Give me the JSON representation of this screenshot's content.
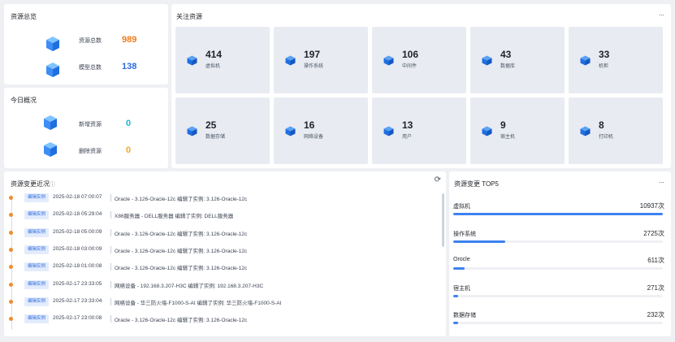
{
  "overview": {
    "title": "资源总览",
    "total_label": "资源总数",
    "total_value": "989",
    "model_label": "模型总数",
    "model_value": "138"
  },
  "today": {
    "title": "今日概况",
    "new_label": "新增资源",
    "new_value": "0",
    "deleted_label": "删除资源",
    "deleted_value": "0"
  },
  "focus": {
    "title": "关注资源",
    "more": "···",
    "tiles": [
      {
        "count": "414",
        "label": "虚拟机"
      },
      {
        "count": "197",
        "label": "操作系统"
      },
      {
        "count": "106",
        "label": "中间件"
      },
      {
        "count": "43",
        "label": "数据库"
      },
      {
        "count": "33",
        "label": "机柜"
      },
      {
        "count": "25",
        "label": "数据存储"
      },
      {
        "count": "16",
        "label": "网络设备"
      },
      {
        "count": "13",
        "label": "用户"
      },
      {
        "count": "9",
        "label": "宿主机"
      },
      {
        "count": "8",
        "label": "打印机"
      }
    ]
  },
  "changes": {
    "title": "资源变更近况",
    "info_icon": "ⓘ",
    "refresh_icon": "⟳",
    "items": [
      {
        "tag": "编辑实例",
        "time": "2025-02-18 07:00:07",
        "msg": "Oracle - 3.126-Oracle-12c   编辑了实例: 3.126-Oracle-12c"
      },
      {
        "tag": "编辑实例",
        "time": "2025-02-18 05:29:04",
        "msg": "X86服务器 - DELL服务器   编辑了实例: DELL服务器"
      },
      {
        "tag": "编辑实例",
        "time": "2025-02-18 05:00:09",
        "msg": "Oracle - 3.126-Oracle-12c   编辑了实例: 3.126-Oracle-12c"
      },
      {
        "tag": "编辑实例",
        "time": "2025-02-18 03:00:09",
        "msg": "Oracle - 3.126-Oracle-12c   编辑了实例: 3.126-Oracle-12c"
      },
      {
        "tag": "编辑实例",
        "time": "2025-02-18 01:00:08",
        "msg": "Oracle - 3.126-Oracle-12c   编辑了实例: 3.126-Oracle-12c"
      },
      {
        "tag": "编辑实例",
        "time": "2025-02-17 23:33:05",
        "msg": "网络设备 - 192.168.3.207-H3C   编辑了实例: 192.168.3.207-H3C"
      },
      {
        "tag": "编辑实例",
        "time": "2025-02-17 23:33:04",
        "msg": "网络设备 - 华三防火墙-F1000-S-AI   编辑了实例: 华三防火墙-F1000-S-AI"
      },
      {
        "tag": "编辑实例",
        "time": "2025-02-17 23:00:08",
        "msg": "Oracle - 3.126-Oracle-12c   编辑了实例: 3.126-Oracle-12c"
      }
    ]
  },
  "top5": {
    "title": "资源变更 TOP5",
    "more": "···",
    "items": [
      {
        "name": "虚拟机",
        "value": "10937次",
        "fraction": 1.0
      },
      {
        "name": "操作系统",
        "value": "2725次",
        "fraction": 0.249
      },
      {
        "name": "Orocle",
        "value": "611次",
        "fraction": 0.056
      },
      {
        "name": "宿主机",
        "value": "271次",
        "fraction": 0.025
      },
      {
        "name": "数据存储",
        "value": "232次",
        "fraction": 0.021
      }
    ]
  },
  "colors": {
    "orange": "#f07a1a",
    "blue": "#2f6bde",
    "cyan": "#1ab3d8",
    "amber": "#f5a623",
    "bar": "#3d82f0"
  }
}
